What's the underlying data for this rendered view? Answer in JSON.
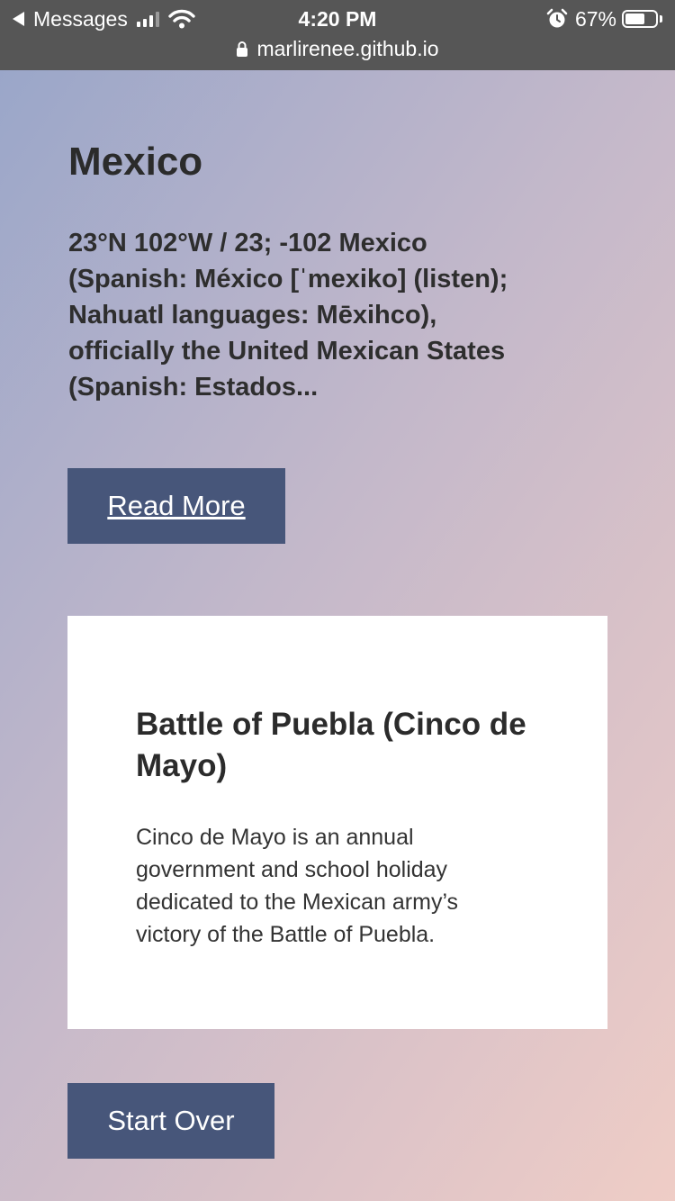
{
  "status_bar": {
    "back_app": "Messages",
    "time": "4:20 PM",
    "battery_percent": "67%",
    "battery_level": 0.67,
    "url": "marlirenee.github.io"
  },
  "country": {
    "name": "Mexico",
    "summary": "23°N 102°W / 23; -102 Mexico (Spanish: México [ˈmexiko] (listen); Nahuatl languages: Mēxihco), officially the United Mexican States (Spanish: Estados..."
  },
  "read_more_label": "Read More",
  "holiday": {
    "title": "Battle of Puebla (Cinco de Mayo)",
    "description": "Cinco de Mayo is an annual government and school holiday dedicated to the Mexican army’s victory of the Battle of Puebla."
  },
  "start_over_label": "Start Over",
  "colors": {
    "button": "#47567a",
    "status_bar": "#565656",
    "card": "#ffffff"
  },
  "icons": [
    "back-arrow-icon",
    "cellular-signal-icon",
    "wifi-icon",
    "alarm-icon",
    "battery-icon",
    "lock-icon"
  ]
}
